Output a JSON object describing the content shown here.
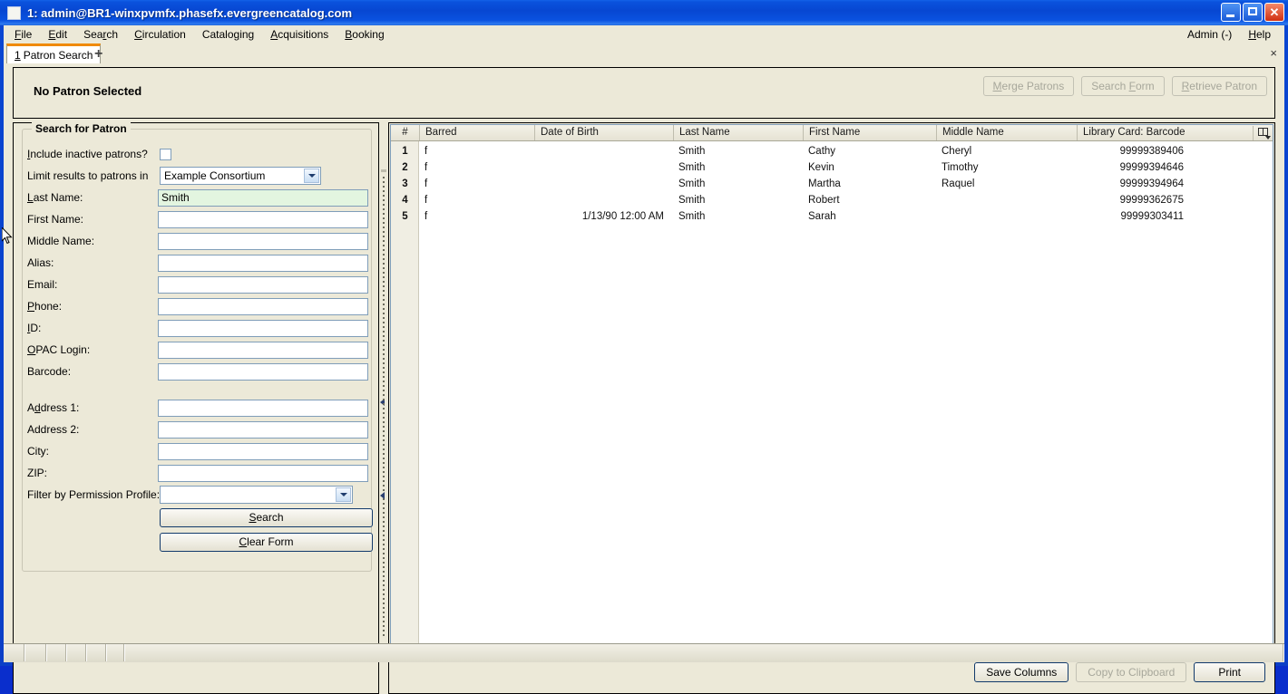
{
  "window": {
    "title": "1: admin@BR1-winxpvmfx.phasefx.evergreencatalog.com",
    "minimize_label": "Minimize",
    "maximize_label": "Maximize",
    "close_label": "Close"
  },
  "menubar": {
    "items": [
      {
        "label": "File",
        "accel": "F"
      },
      {
        "label": "Edit",
        "accel": "E"
      },
      {
        "label": "Search",
        "accel": "r"
      },
      {
        "label": "Circulation",
        "accel": "C"
      },
      {
        "label": "Cataloging",
        "accel": "g"
      },
      {
        "label": "Acquisitions",
        "accel": "A"
      },
      {
        "label": "Booking",
        "accel": "B"
      }
    ],
    "right": [
      {
        "label": "Admin (-)"
      },
      {
        "label": "Help",
        "accel": "H"
      }
    ]
  },
  "tabs": {
    "active": {
      "number": "1",
      "label": "Patron Search"
    },
    "new_tab_glyph": "+",
    "close_glyph": "×"
  },
  "patron_header": {
    "title": "No Patron Selected",
    "buttons": [
      {
        "label": "Merge Patrons",
        "disabled": true
      },
      {
        "label": "Search Form",
        "disabled": true
      },
      {
        "label": "Retrieve Patron",
        "disabled": true
      }
    ]
  },
  "search_form": {
    "group_title": "Search for Patron",
    "fields": [
      {
        "label": "Include inactive patrons?",
        "type": "checkbox",
        "checked": false,
        "value": ""
      },
      {
        "label": "Limit results to patrons in",
        "type": "select",
        "value": "Example Consortium"
      },
      {
        "label": "Last Name:",
        "type": "text",
        "value": "Smith",
        "focused": true
      },
      {
        "label": "First Name:",
        "type": "text",
        "value": ""
      },
      {
        "label": "Middle Name:",
        "type": "text",
        "value": ""
      },
      {
        "label": "Alias:",
        "type": "text",
        "value": ""
      },
      {
        "label": "Email:",
        "type": "text",
        "value": ""
      },
      {
        "label": "Phone:",
        "type": "text",
        "value": ""
      },
      {
        "label": "ID:",
        "type": "text",
        "value": ""
      },
      {
        "label": "OPAC Login:",
        "type": "text",
        "value": ""
      },
      {
        "label": "Barcode:",
        "type": "text",
        "value": ""
      },
      {
        "label": "Address 1:",
        "type": "text",
        "value": ""
      },
      {
        "label": "Address 2:",
        "type": "text",
        "value": ""
      },
      {
        "label": "City:",
        "type": "text",
        "value": ""
      },
      {
        "label": "ZIP:",
        "type": "text",
        "value": ""
      },
      {
        "label": "Filter by Permission Profile:",
        "type": "select",
        "value": ""
      }
    ],
    "search_button": "Search",
    "clear_button": "Clear Form"
  },
  "results": {
    "columns": [
      "#",
      "Barred",
      "Date of Birth",
      "Last Name",
      "First Name",
      "Middle Name",
      "Library Card: Barcode"
    ],
    "rows": [
      {
        "num": "1",
        "barred": "f",
        "dob": "",
        "last": "Smith",
        "first": "Cathy",
        "middle": "Cheryl",
        "barcode": "99999389406"
      },
      {
        "num": "2",
        "barred": "f",
        "dob": "",
        "last": "Smith",
        "first": "Kevin",
        "middle": "Timothy",
        "barcode": "99999394646"
      },
      {
        "num": "3",
        "barred": "f",
        "dob": "",
        "last": "Smith",
        "first": "Martha",
        "middle": "Raquel",
        "barcode": "99999394964"
      },
      {
        "num": "4",
        "barred": "f",
        "dob": "",
        "last": "Smith",
        "first": "Robert",
        "middle": "",
        "barcode": "99999362675"
      },
      {
        "num": "5",
        "barred": "f",
        "dob": "1/13/90 12:00 AM",
        "last": "Smith",
        "first": "Sarah",
        "middle": "",
        "barcode": "99999303411"
      }
    ],
    "column_picker_label": "Column picker",
    "footer_buttons": [
      {
        "label": "Save Columns",
        "disabled": false
      },
      {
        "label": "Copy to Clipboard",
        "disabled": true
      },
      {
        "label": "Print",
        "disabled": false
      }
    ]
  },
  "statusbar": {
    "segments": [
      "",
      "",
      "",
      "",
      "",
      "",
      ""
    ]
  },
  "colors": {
    "titlebar_blue": "#0a46d2",
    "window_bg": "#ece9d8",
    "tab_accent": "#f08a00",
    "focused_field": "#e3f5e0",
    "field_border": "#7f9db9"
  }
}
